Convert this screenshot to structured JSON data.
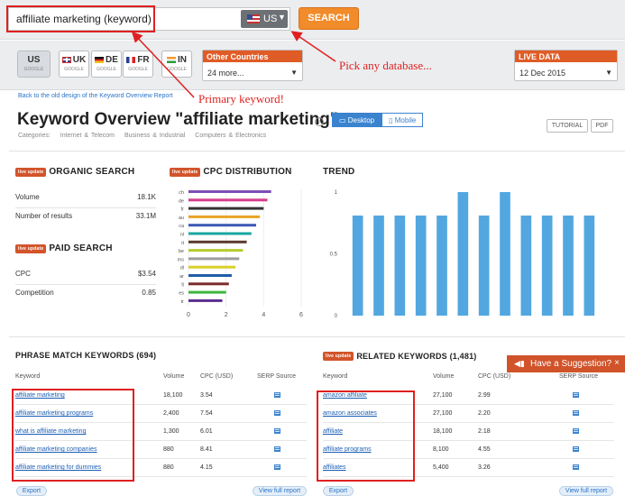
{
  "search": {
    "query": "affiliate marketing (keyword)",
    "database": "US",
    "button": "SEARCH"
  },
  "annotations": {
    "pick_db": "Pick any database...",
    "primary": "Primary keyword!"
  },
  "db_tabs": [
    {
      "code": "US",
      "sub": "GOOGLE",
      "flag": "us"
    },
    {
      "code": "UK",
      "sub": "GOOGLE",
      "flag": "uk"
    },
    {
      "code": "DE",
      "sub": "GOOGLE",
      "flag": "de"
    },
    {
      "code": "FR",
      "sub": "GOOGLE",
      "flag": "fr"
    },
    {
      "code": "IN",
      "sub": "GOOGLE",
      "flag": "in"
    }
  ],
  "other_countries": {
    "label": "Other Countries",
    "value": "24 more..."
  },
  "live_data": {
    "label": "LIVE DATA",
    "value": "12 Dec 2015"
  },
  "back_link": "Back to the old design of the Keyword Overview Report",
  "title": "Keyword Overview \"affiliate marketing\"",
  "categories": {
    "label": "Categories:",
    "items": [
      "Internet & Telecom",
      "Business & Industrial",
      "Computers & Electronics"
    ]
  },
  "device": {
    "desktop": "Desktop",
    "mobile": "Mobile"
  },
  "buttons": {
    "tutorial": "TUTORIAL",
    "pdf": "PDF"
  },
  "badge": "live update",
  "organic": {
    "title": "ORGANIC SEARCH",
    "rows": [
      {
        "k": "Volume",
        "v": "18.1K"
      },
      {
        "k": "Number of results",
        "v": "33.1M"
      }
    ]
  },
  "paid": {
    "title": "PAID SEARCH",
    "rows": [
      {
        "k": "CPC",
        "v": "$3.54"
      },
      {
        "k": "Competition",
        "v": "0.85"
      }
    ]
  },
  "cpc": {
    "title": "CPC DISTRIBUTION"
  },
  "trend": {
    "title": "TREND"
  },
  "chart_data": [
    {
      "type": "bar",
      "orientation": "horizontal",
      "title": "CPC DISTRIBUTION",
      "categories": [
        "ch",
        "de",
        "fr",
        "au",
        "ca",
        "nl",
        "it",
        "be",
        "ms",
        "dl",
        "ar",
        "fi",
        "es",
        "tr"
      ],
      "values": [
        4.4,
        4.2,
        4.0,
        3.8,
        3.6,
        3.35,
        3.1,
        2.9,
        2.7,
        2.5,
        2.3,
        2.15,
        2.0,
        1.8
      ],
      "colors": [
        "#7c4eb6",
        "#d43f8d",
        "#333333",
        "#e9a425",
        "#3d58b6",
        "#18a7a0",
        "#5b3a2e",
        "#b6cc2d",
        "#9d9d9d",
        "#d9cf2b",
        "#1f5da8",
        "#7d2b2b",
        "#3cb83a",
        "#5b2d91"
      ],
      "xticks": [
        0,
        2,
        4,
        6
      ],
      "xlim": [
        0,
        6
      ]
    },
    {
      "type": "bar",
      "title": "TREND",
      "values": [
        0.81,
        0.81,
        0.81,
        0.81,
        0.81,
        1,
        0.81,
        1,
        0.81,
        0.81,
        0.81,
        0.81
      ],
      "yticks": [
        0,
        0.5,
        1
      ],
      "ylim": [
        0,
        1
      ],
      "color": "#52a7e0"
    }
  ],
  "phrase": {
    "title": "PHRASE MATCH KEYWORDS (694)",
    "headers": {
      "kw": "Keyword",
      "vol": "Volume",
      "cpc": "CPC (USD)",
      "serp": "SERP Source"
    },
    "rows": [
      {
        "kw": "affiliate marketing",
        "vol": "18,100",
        "cpc": "3.54"
      },
      {
        "kw": "affiliate marketing programs",
        "vol": "2,400",
        "cpc": "7.54"
      },
      {
        "kw": "what is affiliate marketing",
        "vol": "1,300",
        "cpc": "6.01"
      },
      {
        "kw": "affiliate marketing companies",
        "vol": "880",
        "cpc": "8.41"
      },
      {
        "kw": "affiliate marketing for dummies",
        "vol": "880",
        "cpc": "4.15"
      }
    ]
  },
  "related": {
    "title": "RELATED KEYWORDS (1,481)",
    "headers": {
      "kw": "Keyword",
      "vol": "Volume",
      "cpc": "CPC (USD)",
      "serp": "SERP Source"
    },
    "rows": [
      {
        "kw": "amazon affiliate",
        "vol": "27,100",
        "cpc": "2.99"
      },
      {
        "kw": "amazon associates",
        "vol": "27,100",
        "cpc": "2.20"
      },
      {
        "kw": "affiliate",
        "vol": "18,100",
        "cpc": "2.18"
      },
      {
        "kw": "affiliate programs",
        "vol": "8,100",
        "cpc": "4.55"
      },
      {
        "kw": "affiliates",
        "vol": "5,400",
        "cpc": "3.26"
      }
    ]
  },
  "footer": {
    "export": "Export",
    "full_report": "View full report"
  },
  "suggestion": {
    "label": "Have a Suggestion?",
    "close": "×"
  }
}
